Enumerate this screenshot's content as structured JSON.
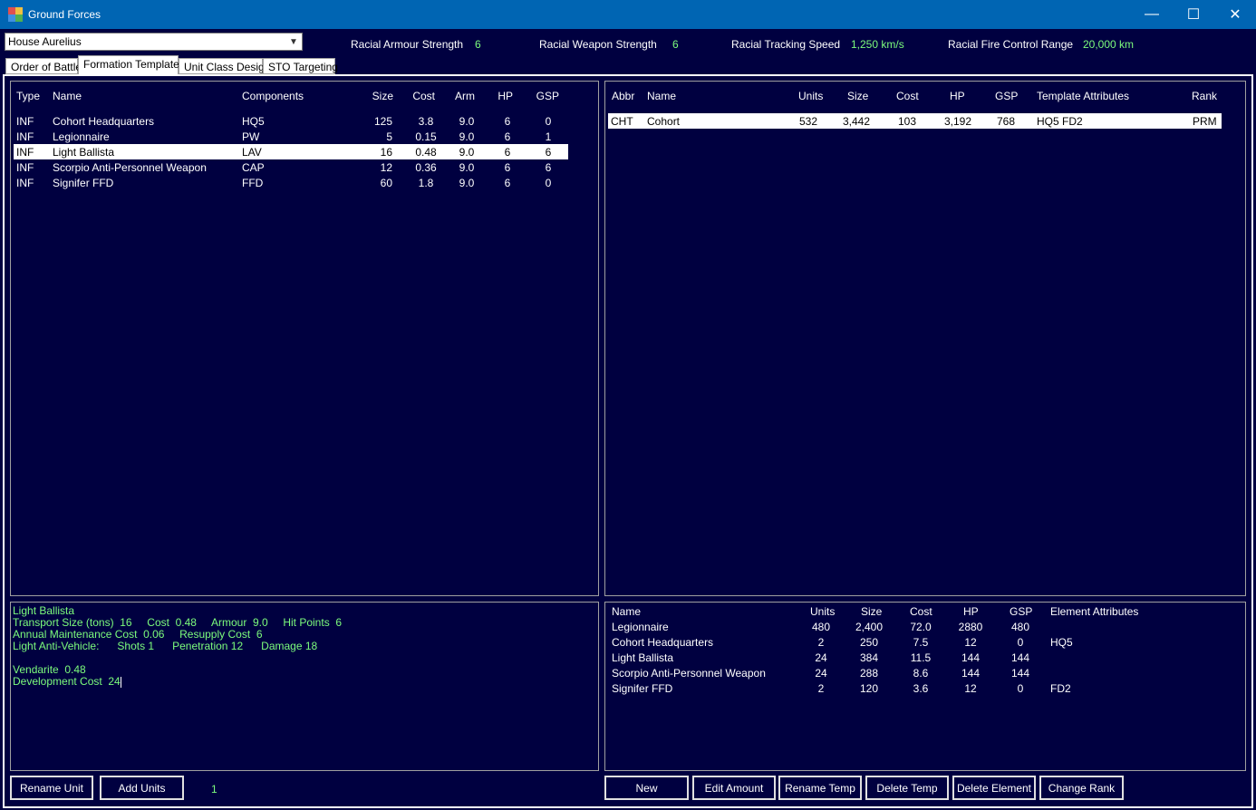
{
  "window": {
    "title": "Ground Forces"
  },
  "controls": {
    "minimize": "—",
    "maximize": "☐",
    "close": "✕"
  },
  "race_select": {
    "value": "House Aurelius"
  },
  "racial_stats": [
    {
      "label": "Racial Armour Strength",
      "value": "6"
    },
    {
      "label": "Racial Weapon Strength",
      "value": "6"
    },
    {
      "label": "Racial Tracking Speed",
      "value": "1,250 km/s"
    },
    {
      "label": "Racial Fire Control Range",
      "value": "20,000 km"
    }
  ],
  "tabs": [
    {
      "label": "Order of Battle",
      "active": false
    },
    {
      "label": "Formation Templates",
      "active": true
    },
    {
      "label": "Unit Class Design",
      "active": false
    },
    {
      "label": "STO Targeting",
      "active": false
    }
  ],
  "unit_table": {
    "headers": {
      "type": "Type",
      "name": "Name",
      "components": "Components",
      "size": "Size",
      "cost": "Cost",
      "arm": "Arm",
      "hp": "HP",
      "gsp": "GSP"
    },
    "rows": [
      {
        "type": "INF",
        "name": "Cohort Headquarters",
        "components": "HQ5",
        "size": "125",
        "cost": "3.8",
        "arm": "9.0",
        "hp": "6",
        "gsp": "0"
      },
      {
        "type": "INF",
        "name": "Legionnaire",
        "components": "PW",
        "size": "5",
        "cost": "0.15",
        "arm": "9.0",
        "hp": "6",
        "gsp": "1"
      },
      {
        "type": "INF",
        "name": "Light Ballista",
        "components": "LAV",
        "size": "16",
        "cost": "0.48",
        "arm": "9.0",
        "hp": "6",
        "gsp": "6"
      },
      {
        "type": "INF",
        "name": "Scorpio Anti-Personnel Weapon",
        "components": "CAP",
        "size": "12",
        "cost": "0.36",
        "arm": "9.0",
        "hp": "6",
        "gsp": "6"
      },
      {
        "type": "INF",
        "name": "Signifer FFD",
        "components": "FFD",
        "size": "60",
        "cost": "1.8",
        "arm": "9.0",
        "hp": "6",
        "gsp": "0"
      }
    ],
    "selected_index": 2
  },
  "template_table": {
    "headers": {
      "abbr": "Abbr",
      "name": "Name",
      "units": "Units",
      "size": "Size",
      "cost": "Cost",
      "hp": "HP",
      "gsp": "GSP",
      "attrs": "Template Attributes",
      "rank": "Rank"
    },
    "rows": [
      {
        "abbr": "CHT",
        "name": "Cohort",
        "units": "532",
        "size": "3,442",
        "cost": "103",
        "hp": "3,192",
        "gsp": "768",
        "attrs": "HQ5  FD2",
        "rank": "PRM"
      }
    ],
    "selected_index": 0
  },
  "unit_info": {
    "lines": [
      "Light Ballista",
      "Transport Size (tons)  16     Cost  0.48     Armour  9.0     Hit Points  6",
      "Annual Maintenance Cost  0.06     Resupply Cost  6",
      "Light Anti-Vehicle:      Shots 1      Penetration 12      Damage 18",
      "",
      "Vendarite  0.48",
      "Development Cost  24"
    ]
  },
  "element_table": {
    "headers": {
      "name": "Name",
      "units": "Units",
      "size": "Size",
      "cost": "Cost",
      "hp": "HP",
      "gsp": "GSP",
      "attrs": "Element Attributes"
    },
    "rows": [
      {
        "name": "Legionnaire",
        "units": "480",
        "size": "2,400",
        "cost": "72.0",
        "hp": "2880",
        "gsp": "480",
        "attrs": ""
      },
      {
        "name": "Cohort Headquarters",
        "units": "2",
        "size": "250",
        "cost": "7.5",
        "hp": "12",
        "gsp": "0",
        "attrs": "HQ5"
      },
      {
        "name": "Light Ballista",
        "units": "24",
        "size": "384",
        "cost": "11.5",
        "hp": "144",
        "gsp": "144",
        "attrs": ""
      },
      {
        "name": "Scorpio Anti-Personnel Weapon",
        "units": "24",
        "size": "288",
        "cost": "8.6",
        "hp": "144",
        "gsp": "144",
        "attrs": ""
      },
      {
        "name": "Signifer FFD",
        "units": "2",
        "size": "120",
        "cost": "3.6",
        "hp": "12",
        "gsp": "0",
        "attrs": "FD2"
      }
    ]
  },
  "left_buttons": {
    "rename_unit": "Rename Unit",
    "add_units": "Add Units",
    "amount": "1"
  },
  "right_buttons": {
    "new": "New",
    "edit_amount": "Edit Amount",
    "rename_temp": "Rename Temp",
    "delete_temp": "Delete Temp",
    "delete_element": "Delete Element",
    "change_rank": "Change Rank"
  },
  "colors": {
    "background": "#000040",
    "titlebar": "#0065b3",
    "value_text": "#7cfc7c",
    "text": "#ffffff"
  }
}
